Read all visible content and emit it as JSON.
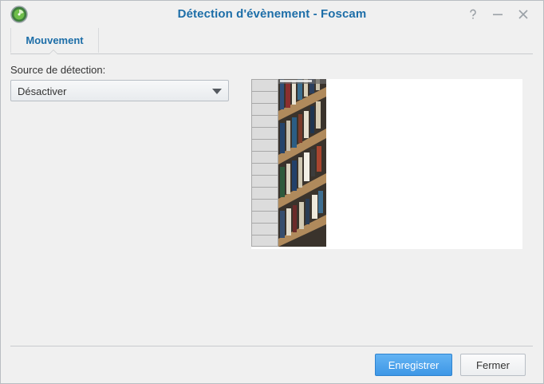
{
  "window": {
    "title": "Détection d'évènement - Foscam"
  },
  "tabs": [
    {
      "label": "Mouvement",
      "selected": true
    }
  ],
  "form": {
    "source_label": "Source de détection:",
    "source_value": "Désactiver"
  },
  "footer": {
    "save_label": "Enregistrer",
    "close_label": "Fermer"
  },
  "icons": {
    "app": "synology-surveillance-icon",
    "help": "help-icon",
    "minimize": "minimize-icon",
    "close": "close-icon",
    "dropdown": "chevron-down-icon"
  },
  "colors": {
    "title": "#1d6ea8",
    "primary_button": "#3e97e6",
    "window_background": "#f0f0f0"
  }
}
